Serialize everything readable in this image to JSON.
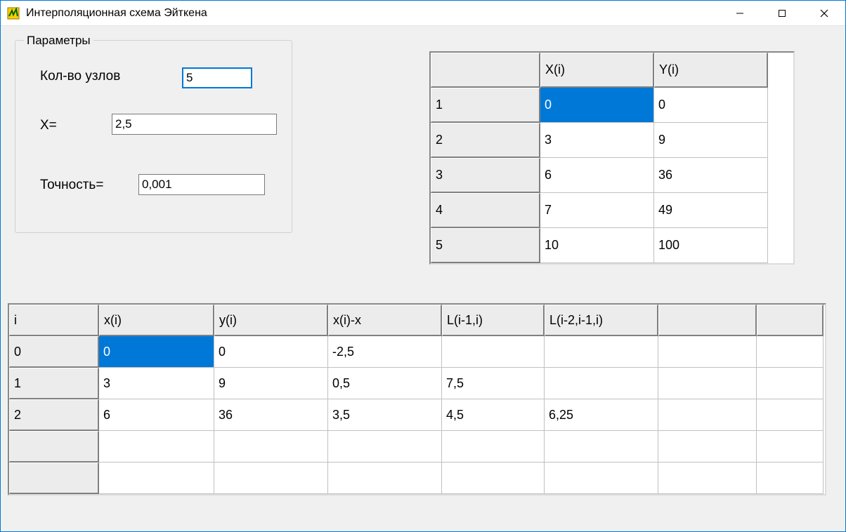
{
  "window": {
    "title": "Интерполяционная схема Эйткена"
  },
  "params": {
    "group_title": "Параметры",
    "nodes_label": "Кол-во узлов",
    "nodes_value": "5",
    "x_label": "X=",
    "x_value": "2,5",
    "precision_label": "Точность=",
    "precision_value": "0,001"
  },
  "nodes_grid": {
    "headers": [
      "",
      "X(i)",
      "Y(i)"
    ],
    "rows": [
      {
        "idx": "1",
        "x": "0",
        "y": "0",
        "selected_col": 1
      },
      {
        "idx": "2",
        "x": "3",
        "y": "9"
      },
      {
        "idx": "3",
        "x": "6",
        "y": "36"
      },
      {
        "idx": "4",
        "x": "7",
        "y": "49"
      },
      {
        "idx": "5",
        "x": "10",
        "y": "100"
      }
    ]
  },
  "calc_grid": {
    "headers": [
      "i",
      "x(i)",
      "y(i)",
      "x(i)-x",
      "L(i-1,i)",
      "L(i-2,i-1,i)",
      "",
      ""
    ],
    "rows": [
      {
        "c0": "0",
        "c1": "0",
        "c2": "0",
        "c3": "-2,5",
        "c4": "",
        "c5": "",
        "c6": "",
        "c7": "",
        "selected_col": 1
      },
      {
        "c0": "1",
        "c1": "3",
        "c2": "9",
        "c3": "0,5",
        "c4": "7,5",
        "c5": "",
        "c6": "",
        "c7": ""
      },
      {
        "c0": "2",
        "c1": "6",
        "c2": "36",
        "c3": "3,5",
        "c4": "4,5",
        "c5": "6,25",
        "c6": "",
        "c7": ""
      },
      {
        "c0": "",
        "c1": "",
        "c2": "",
        "c3": "",
        "c4": "",
        "c5": "",
        "c6": "",
        "c7": ""
      },
      {
        "c0": "",
        "c1": "",
        "c2": "",
        "c3": "",
        "c4": "",
        "c5": "",
        "c6": "",
        "c7": ""
      }
    ]
  }
}
